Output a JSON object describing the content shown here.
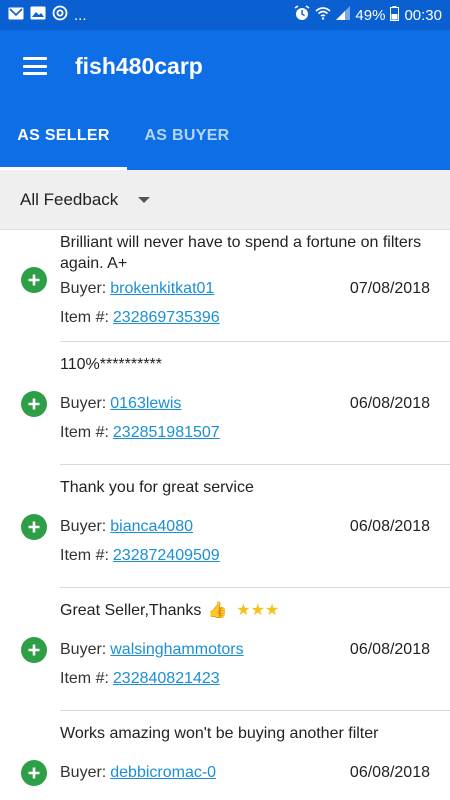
{
  "status_bar": {
    "left_icons": [
      "mail-icon",
      "image-icon",
      "at-icon"
    ],
    "ellipsis": "...",
    "battery": "49%",
    "time": "00:30"
  },
  "app_bar": {
    "title": "fish480carp"
  },
  "tabs": [
    {
      "label": "AS SELLER",
      "active": true
    },
    {
      "label": "AS BUYER",
      "active": false
    }
  ],
  "filter": {
    "selected": "All Feedback"
  },
  "feedback": [
    {
      "comment": "Brilliant will never have to spend a fortune on filters again. A+",
      "buyer_label": "Buyer:",
      "buyer": "brokenkitkat01",
      "date": "07/08/2018",
      "item_label": "Item #:",
      "item": "232869735396"
    },
    {
      "comment": "110%**********",
      "buyer_label": "Buyer:",
      "buyer": "0163lewis",
      "date": "06/08/2018",
      "item_label": "Item #:",
      "item": "232851981507"
    },
    {
      "comment": "Thank you for great service",
      "buyer_label": "Buyer:",
      "buyer": "bianca4080",
      "date": "06/08/2018",
      "item_label": "Item #:",
      "item": "232872409509"
    },
    {
      "comment": "Great Seller,Thanks",
      "comment_emoji": "👍",
      "comment_stars": "★★★",
      "buyer_label": "Buyer:",
      "buyer": "walsinghammotors",
      "date": "06/08/2018",
      "item_label": "Item #:",
      "item": "232840821423"
    },
    {
      "comment": "Works amazing won't be buying another filter",
      "buyer_label": "Buyer:",
      "buyer": "debbicromac-0",
      "date": "06/08/2018"
    }
  ]
}
